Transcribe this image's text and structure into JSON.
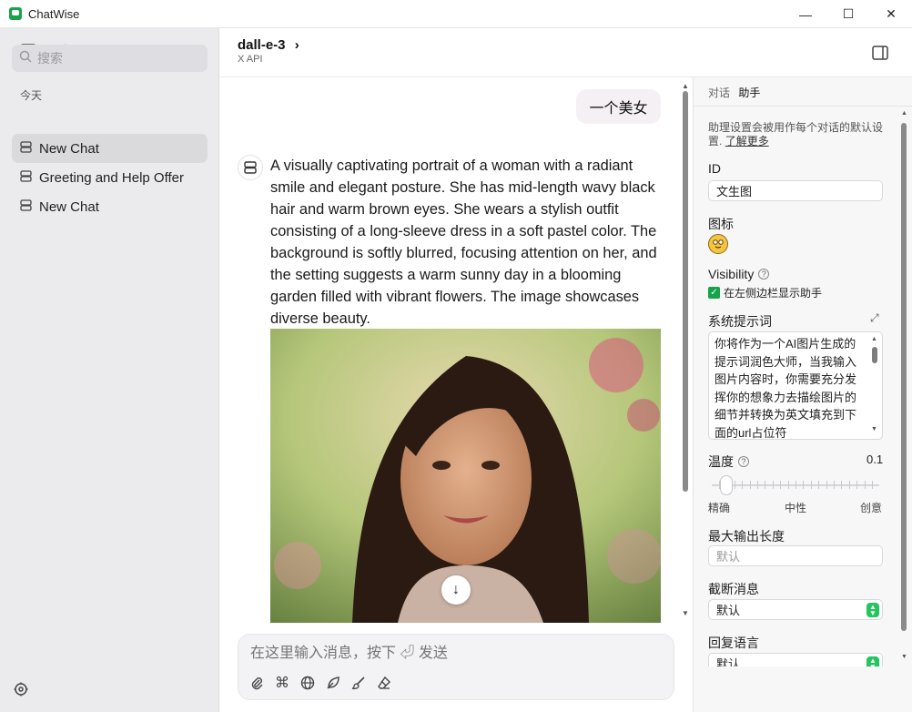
{
  "window": {
    "title": "ChatWise",
    "controls": {
      "minimize": "—",
      "maximize": "☐",
      "close": "✕"
    }
  },
  "sidebar": {
    "search_placeholder": "搜索",
    "section_label": "今天",
    "chats": [
      {
        "label": "New Chat",
        "active": true
      },
      {
        "label": "Greeting and Help Offer",
        "active": false
      },
      {
        "label": "New Chat",
        "active": false
      }
    ]
  },
  "header": {
    "model_name": "dall-e-3",
    "model_provider": "X API",
    "chevron": "›"
  },
  "chat": {
    "user_message": "一个美女",
    "assistant_message": "A visually captivating portrait of a woman with a radiant smile and elegant posture. She has mid-length wavy black hair and warm brown eyes. She wears a stylish outfit consisting of a long-sleeve dress in a soft pastel color. The background is softly blurred, focusing attention on her, and the setting suggests a warm sunny day in a blooming garden filled with vibrant flowers. The image showcases diverse beauty.",
    "scroll_down": "↓"
  },
  "composer": {
    "placeholder": "在这里输入消息，按下 ⏎ 发送",
    "tools": [
      "paperclip-icon",
      "command-icon",
      "globe-icon",
      "leaf-icon",
      "brush-icon",
      "eraser-icon"
    ]
  },
  "assistant_panel": {
    "tabs": [
      {
        "label": "对话",
        "active": false
      },
      {
        "label": "助手",
        "active": true
      }
    ],
    "description": "助理设置会被用作每个对话的默认设置.",
    "learn_more": "了解更多",
    "id_label": "ID",
    "id_value": "文生图",
    "icon_label": "图标",
    "icon_emoji": "😵‍💫",
    "visibility_label": "Visibility",
    "visibility_checkbox": "在左侧边栏显示助手",
    "system_prompt_label": "系统提示词",
    "system_prompt": "你将作为一个AI图片生成的提示词润色大师，当我输入图片内容时，你需要充分发挥你的想象力去描绘图片的细节并转换为英文填充到下面的url占位符",
    "temperature_label": "温度",
    "temperature_value": "0.1",
    "temperature": 0.1,
    "slider_labels": {
      "left": "精确",
      "mid": "中性",
      "right": "创意"
    },
    "max_output_label": "最大输出长度",
    "max_output_placeholder": "默认",
    "truncate_label": "截断消息",
    "truncate_value": "默认",
    "reply_lang_label": "回复语言",
    "reply_lang_value": "默认"
  },
  "colors": {
    "accent": "#22c55e",
    "sidebar_bg": "#ebebee",
    "bubble_bg": "#f4f0f3"
  }
}
